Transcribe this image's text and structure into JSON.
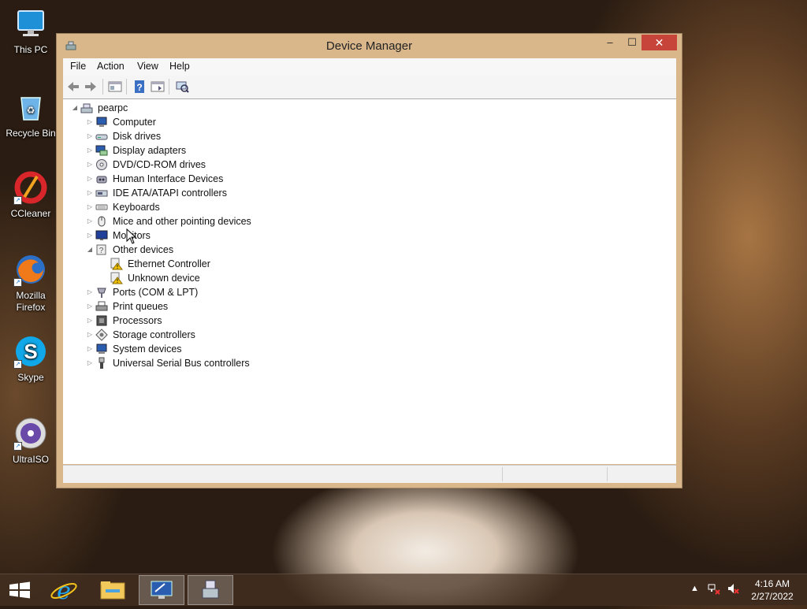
{
  "desktop": {
    "icons": [
      {
        "label": "This PC",
        "icon": "computer-icon"
      },
      {
        "label": "Recycle Bin",
        "icon": "recycle-bin-icon"
      },
      {
        "label": "CCleaner",
        "icon": "ccleaner-icon"
      },
      {
        "label_line1": "Mozilla",
        "label_line2": "Firefox",
        "icon": "firefox-icon"
      },
      {
        "label": "Skype",
        "icon": "skype-icon"
      },
      {
        "label": "UltraISO",
        "icon": "ultraiso-icon"
      }
    ]
  },
  "window": {
    "title": "Device Manager",
    "buttons": {
      "minimize": "–",
      "maximize": "☐",
      "close": "✕"
    },
    "menu": [
      "File",
      "Action",
      "View",
      "Help"
    ],
    "toolbar": [
      "back",
      "forward",
      "properties",
      "help",
      "show-hidden",
      "scan-hardware"
    ],
    "tree": {
      "root": "pearpc",
      "categories": [
        {
          "label": "Computer",
          "icon": "computer-icon",
          "expanded": false
        },
        {
          "label": "Disk drives",
          "icon": "disk-drive-icon",
          "expanded": false
        },
        {
          "label": "Display adapters",
          "icon": "display-adapter-icon",
          "expanded": false
        },
        {
          "label": "DVD/CD-ROM drives",
          "icon": "dvd-drive-icon",
          "expanded": false
        },
        {
          "label": "Human Interface Devices",
          "icon": "hid-icon",
          "expanded": false
        },
        {
          "label": "IDE ATA/ATAPI controllers",
          "icon": "ide-controller-icon",
          "expanded": false
        },
        {
          "label": "Keyboards",
          "icon": "keyboard-icon",
          "expanded": false
        },
        {
          "label": "Mice and other pointing devices",
          "icon": "mouse-icon",
          "expanded": false
        },
        {
          "label": "Monitors",
          "icon": "monitor-icon",
          "expanded": false
        },
        {
          "label": "Other devices",
          "icon": "unknown-device-icon",
          "expanded": true,
          "children": [
            {
              "label": "Ethernet Controller",
              "icon": "warning-device-icon"
            },
            {
              "label": "Unknown device",
              "icon": "warning-device-icon"
            }
          ]
        },
        {
          "label": "Ports (COM & LPT)",
          "icon": "port-icon",
          "expanded": false
        },
        {
          "label": "Print queues",
          "icon": "printer-icon",
          "expanded": false
        },
        {
          "label": "Processors",
          "icon": "processor-icon",
          "expanded": false
        },
        {
          "label": "Storage controllers",
          "icon": "storage-controller-icon",
          "expanded": false
        },
        {
          "label": "System devices",
          "icon": "system-device-icon",
          "expanded": false
        },
        {
          "label": "Universal Serial Bus controllers",
          "icon": "usb-icon",
          "expanded": false
        }
      ]
    }
  },
  "taskbar": {
    "items": [
      "start-button",
      "internet-explorer",
      "file-explorer",
      "remote-desktop",
      "device-manager"
    ],
    "clock": {
      "time": "4:16 AM",
      "date": "2/27/2022"
    }
  },
  "colors": {
    "close_button": "#c7443a",
    "window_frame": "#d9b78b",
    "warning": "#f2c200"
  }
}
